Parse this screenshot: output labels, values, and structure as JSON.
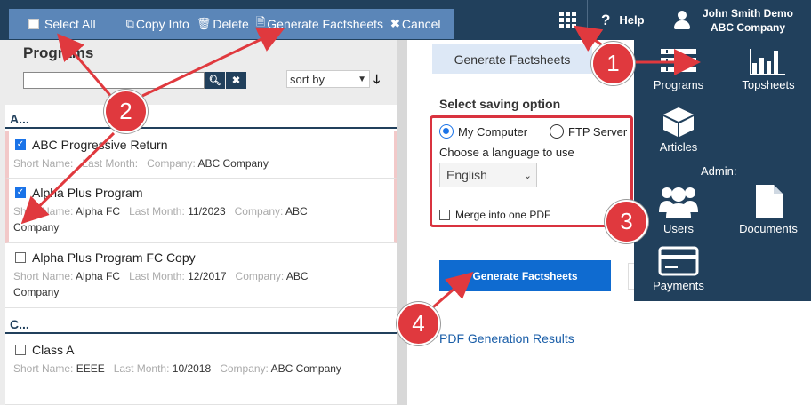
{
  "toolbar": {
    "select_all": "Select All",
    "copy_into": "Copy Into",
    "delete": "Delete",
    "generate_factsheets": "Generate Factsheets",
    "cancel": "Cancel"
  },
  "header": {
    "help": "Help",
    "user_name": "John Smith Demo",
    "company": "ABC Company"
  },
  "programs_panel": {
    "title": "Programs",
    "search_value": "",
    "sort_by": "sort by",
    "groups": [
      {
        "label": "A...",
        "items": [
          {
            "name": "ABC Progressive Return",
            "checked": true,
            "short_name_label": "Short Name:",
            "short_name": "",
            "last_month_label": "Last Month:",
            "last_month": "",
            "company_label": "Company:",
            "company": "ABC Company"
          },
          {
            "name": "Alpha Plus Program",
            "checked": true,
            "short_name_label": "Short Name:",
            "short_name": "Alpha FC",
            "last_month_label": "Last Month:",
            "last_month": "11/2023",
            "company_label": "Company:",
            "company": "ABC Company"
          },
          {
            "name": "Alpha Plus Program FC Copy",
            "checked": false,
            "short_name_label": "Short Name:",
            "short_name": "Alpha FC",
            "last_month_label": "Last Month:",
            "last_month": "12/2017",
            "company_label": "Company:",
            "company": "ABC Company"
          }
        ]
      },
      {
        "label": "C...",
        "items": [
          {
            "name": "Class A",
            "checked": false,
            "short_name_label": "Short Name:",
            "short_name": "EEEE",
            "last_month_label": "Last Month:",
            "last_month": "10/2018",
            "company_label": "Company:",
            "company": "ABC Company"
          }
        ]
      }
    ]
  },
  "factsheet_panel": {
    "tab": "Generate Factsheets",
    "saving_title": "Select saving option",
    "options": [
      "My Computer",
      "FTP Server"
    ],
    "selected_option": "My Computer",
    "language_label": "Choose a language to use",
    "language": "English",
    "merge_label": "Merge into one PDF",
    "merge_checked": false,
    "generate_button": "Generate Factsheets",
    "results_link": "PDF Generation Results"
  },
  "right_nav": {
    "items": [
      "Programs",
      "Topsheets",
      "Articles"
    ],
    "admin_label": "Admin:",
    "admin_items": [
      "Users",
      "Documents",
      "Payments"
    ]
  },
  "annotations": [
    "1",
    "2",
    "3",
    "4"
  ],
  "colors": {
    "header_bg": "#21405c",
    "toolbar_bg": "#5b86b8",
    "primary_button": "#0f6bd0",
    "annotation_red": "#e0393e"
  }
}
